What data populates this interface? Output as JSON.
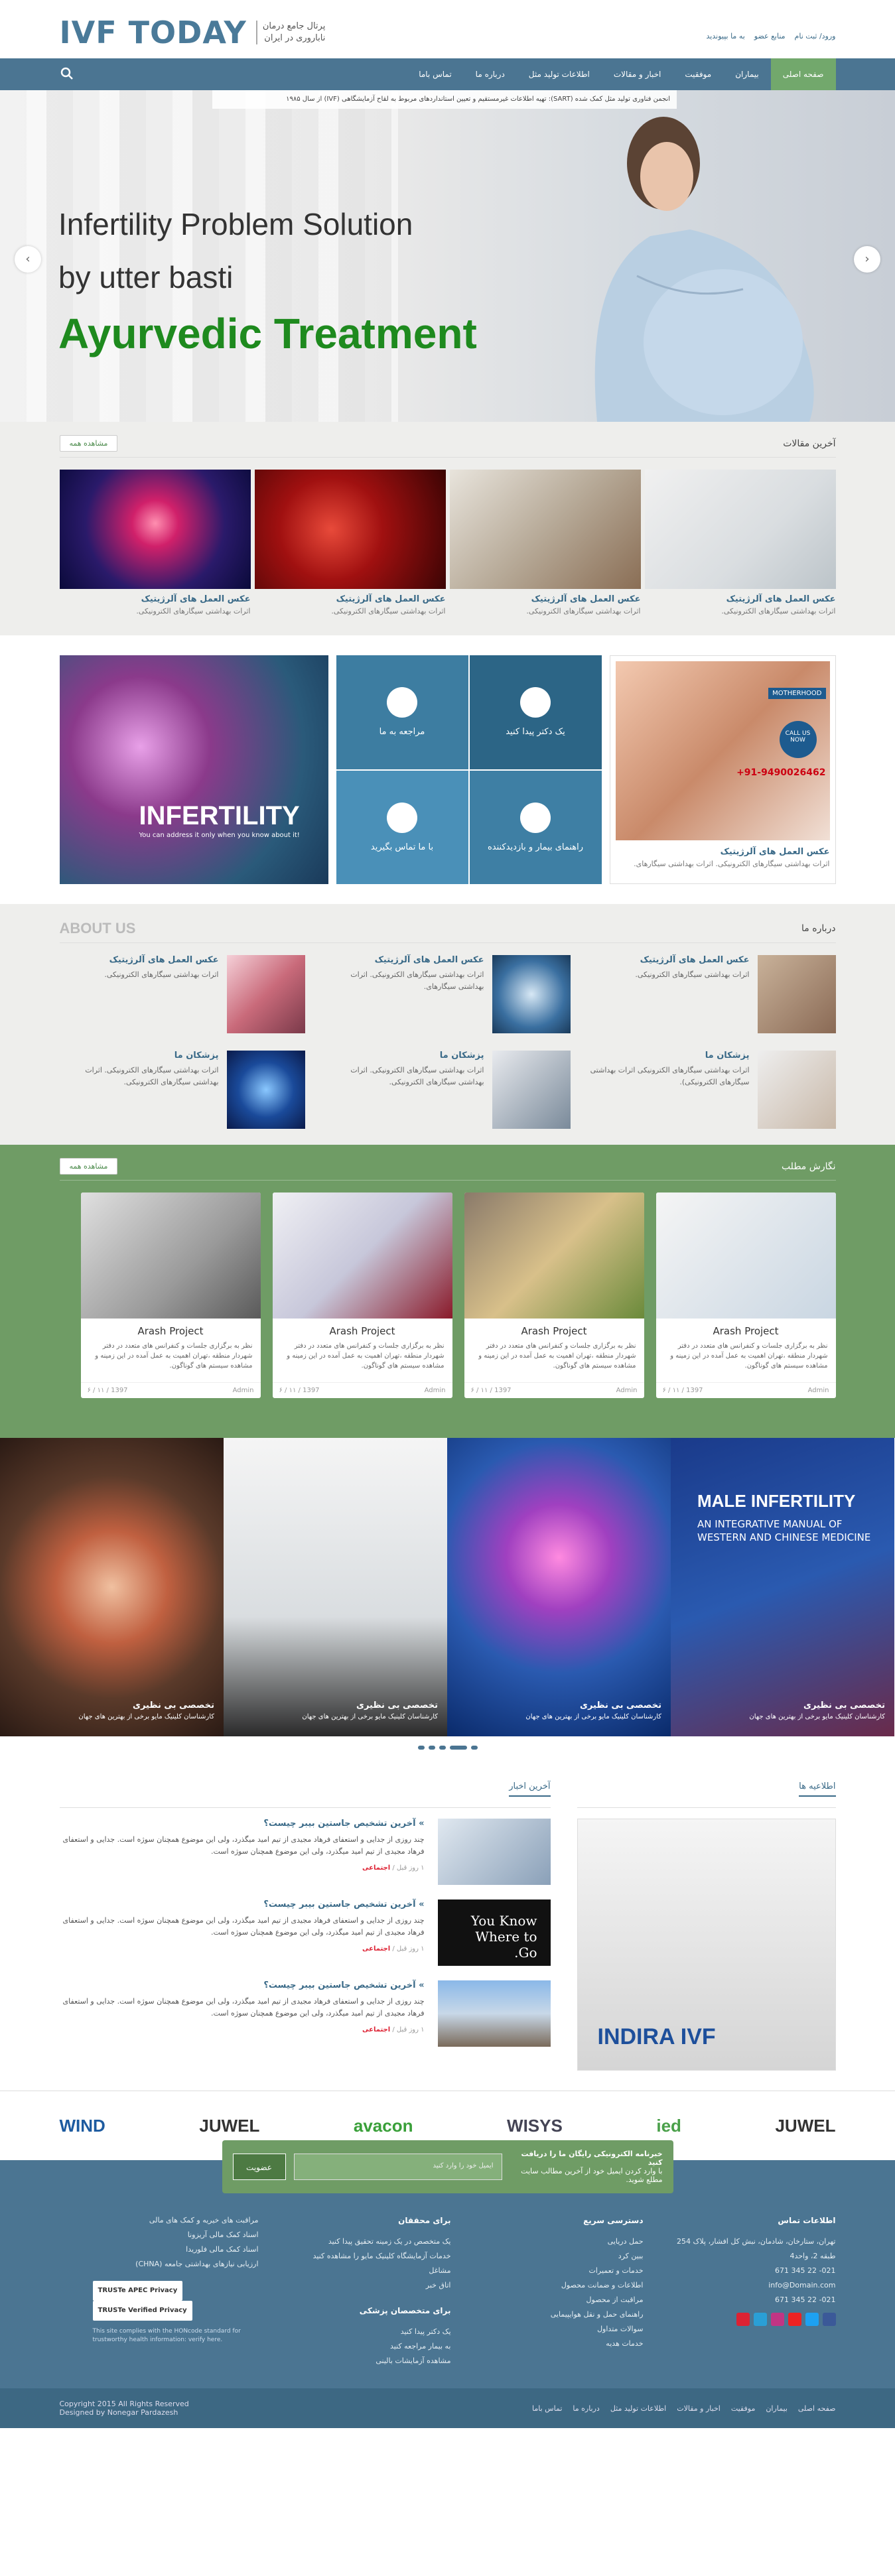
{
  "brand": {
    "logo_text": "IVF TODAY",
    "subtitle_1": "پرتال جامع درمان",
    "subtitle_2": "ناباروری در ایران"
  },
  "toplinks": [
    "ورود/ ثبت نام",
    "منابع عضو",
    "به ما بپیوندید"
  ],
  "nav": {
    "items": [
      "صفحه اصلی",
      "بیماران",
      "موفقیت",
      "اخبار و مقالات",
      "اطلاعات تولید مثل",
      "درباره ما",
      "تماس باما"
    ],
    "active": 0
  },
  "hero": {
    "ticker": "انجمن فناوری تولید مثل کمک شده (SART): تهیه اطلاعات غیرمستقیم و تعیین استانداردهای مربوط به لقاح آزمایشگاهی (IVF) از سال ۱۹۸۵",
    "line1": "Infertility Problem Solution",
    "line2": "by utter basti",
    "line3": "Ayurvedic Treatment",
    "prev": "‹",
    "next": "›"
  },
  "articles": {
    "title": "آخرین مقالات",
    "view_all": "مشاهده همه",
    "items": [
      {
        "title": "عکس العمل های آلرژیتیک",
        "desc": "اثرات بهداشتی سیگارهای الکترونیکی."
      },
      {
        "title": "عکس العمل های آلرژیتیک",
        "desc": "اثرات بهداشتی سیگارهای الکترونیکی."
      },
      {
        "title": "عکس العمل های آلرژیتیک",
        "desc": "اثرات بهداشتی سیگارهای الکترونیکی."
      },
      {
        "title": "عکس العمل های آلرژیتیک",
        "desc": "اثرات بهداشتی سیگارهای الکترونیکی."
      }
    ]
  },
  "services": {
    "banner_big": "INFERTILITY",
    "banner_small": "You can address it only when you know about it!",
    "tiles": [
      "یک دکتر پیدا کنید",
      "مراجعه به ما",
      "راهنمای بیمار و بازدیدکننده",
      "با ما تماس بگیرید"
    ],
    "feature": {
      "badge": "MOTHERHOOD",
      "call": "CALL US NOW",
      "phone": "+91-9490026462",
      "title": "عکس العمل های آلرژیتیک",
      "desc": "اثرات بهداشتی سیگارهای الکترونیکی. اثرات بهداشتی سیگارهای."
    }
  },
  "about": {
    "title_en": "ABOUT US",
    "title_fa": "درباره ما",
    "items": [
      {
        "title": "عکس العمل های آلرژیتیک",
        "desc": "اثرات بهداشتی سیگارهای الکترونیکی."
      },
      {
        "title": "عکس العمل های آلرژیتیک",
        "desc": "اثرات بهداشتی سیگارهای الکترونیکی. اثرات بهداشتی سیگارهای."
      },
      {
        "title": "عکس العمل های آلرژیتیک",
        "desc": "اثرات بهداشتی سیگارهای الکترونیکی."
      },
      {
        "title": "پزشکان ما",
        "desc": "اثرات بهداشتی سیگارهای الکترونیکی اثرات بهداشتی سیگارهای الکترونیکی)."
      },
      {
        "title": "پزشکان ما",
        "desc": "اثرات بهداشتی سیگارهای الکترونیکی. اثرات بهداشتی سیگارهای الکترونیکی."
      },
      {
        "title": "پزشکان ما",
        "desc": "اثرات بهداشتی سیگارهای الکترونیکی. اثرات بهداشتی سیگارهای الکترونیکی."
      }
    ]
  },
  "projects": {
    "title": "نگارش مطلب",
    "view_all": "مشاهده همه",
    "items": [
      {
        "title": "Arash Project",
        "desc": "نظر به برگزاری جلسات و کنفرانس های متعدد در دفتر شهردار منطقه ،تهران اهمیت به عمل آمده در این زمینه و مشاهده سیستم های گوناگون.",
        "date": "1397 / ۱۱ / ۶",
        "author": "Admin"
      },
      {
        "title": "Arash Project",
        "desc": "نظر به برگزاری جلسات و کنفرانس های متعدد در دفتر شهردار منطقه ،تهران اهمیت به عمل آمده در این زمینه و مشاهده سیستم های گوناگون.",
        "date": "1397 / ۱۱ / ۶",
        "author": "Admin"
      },
      {
        "title": "Arash Project",
        "desc": "نظر به برگزاری جلسات و کنفرانس های متعدد در دفتر شهردار منطقه ،تهران اهمیت به عمل آمده در این زمینه و مشاهده سیستم های گوناگون.",
        "date": "1397 / ۱۱ / ۶",
        "author": "Admin"
      },
      {
        "title": "Arash Project",
        "desc": "نظر به برگزاری جلسات و کنفرانس های متعدد در دفتر شهردار منطقه ،تهران اهمیت به عمل آمده در این زمینه و مشاهده سیستم های گوناگون.",
        "date": "1397 / ۱۱ / ۶",
        "author": "Admin"
      }
    ]
  },
  "banner": {
    "items": [
      {
        "a": "تخصصی بی نظیری",
        "b": "کارشناسان کلینیک مایو برخی از بهترین های جهان"
      },
      {
        "a": "تخصصی بی نظیری",
        "b": "کارشناسان کلینیک مایو برخی از بهترین های جهان"
      },
      {
        "a": "تخصصی بی نظیری",
        "b": "کارشناسان کلینیک مایو برخی از بهترین های جهان"
      },
      {
        "a": "تخصصی بی نظیری",
        "b": "کارشناسان کلینیک مایو برخی از بهترین های جهان"
      }
    ],
    "book_title": "MALE INFERTILITY",
    "book_sub": "AN INTEGRATIVE MANUAL OF WESTERN AND CHINESE MEDICINE"
  },
  "news": {
    "tab_news": "آخرین اخبار",
    "tab_ads": "اطلاعیه ها",
    "ad_brand": "INDIRA IVF",
    "img2_text": "You Know Where to Go.",
    "items": [
      {
        "title": "» آخرین تشخیص جاستین بیبر چیست؟",
        "desc": "چند روزی از جدایی و استعفای فرهاد مجیدی از تیم امید میگذرد، ولی این موضوع همچنان سوژه است. جدایی و استعفای فرهاد مجیدی از تیم امید میگذرد، ولی این موضوع همچنان سوژه است.",
        "meta": "۱ روز قبل /",
        "tag": "اجتماعی"
      },
      {
        "title": "» آخرین تشخیص جاستین بیبر چیست؟",
        "desc": "چند روزی از جدایی و استعفای فرهاد مجیدی از تیم امید میگذرد، ولی این موضوع همچنان سوژه است. جدایی و استعفای فرهاد مجیدی از تیم امید میگذرد، ولی این موضوع همچنان سوژه است.",
        "meta": "۱ روز قبل /",
        "tag": "اجتماعی"
      },
      {
        "title": "» آخرین تشخیص جاستین بیبر چیست؟",
        "desc": "چند روزی از جدایی و استعفای فرهاد مجیدی از تیم امید میگذرد، ولی این موضوع همچنان سوژه است. جدایی و استعفای فرهاد مجیدی از تیم امید میگذرد، ولی این موضوع همچنان سوژه است.",
        "meta": "۱ روز قبل /",
        "tag": "اجتماعی"
      }
    ]
  },
  "logos": [
    "WIND",
    "JUWEL",
    "avacon",
    "WISYS",
    "ied",
    "JUWEL"
  ],
  "newsletter": {
    "title": "خبرنامه الکترونیکی رایگان ما را دریافت کنید",
    "subtitle": "با وارد کردن ایمیل خود از آخرین مطالب سایت مطلع شوید.",
    "placeholder": "ایمیل خود را وارد کنید",
    "button": "عضویت"
  },
  "footer": {
    "contact": {
      "title": "اطلاعات تماس",
      "address": "تهران، ستارخان، شادمان، نبش کل افشار، پلاک 254 طبقه 2، واحد4",
      "phone1": "021- 22 345 671",
      "email": "info@Domain.com",
      "phone2": "021- 22 345 671"
    },
    "access": {
      "title": "دسترسی سریع",
      "items": [
        "حمل دریایی",
        "ببین کرد",
        "خدمات و تعمیرات",
        "اطلاعات و ضمانت محصول",
        "مراقبت از محصول",
        "راهنمای حمل و نقل هوایپیمایی",
        "سوالات متداول",
        "خدمات هدیه"
      ]
    },
    "researchers": {
      "title": "برای محققان",
      "items": [
        "یک متخصص در یک زمینه تحقیق پیدا کنید",
        "خدمات آزمایشگاه کلینیک مایو را مشاهده کنید",
        "مشاغل",
        "اتاق خبر"
      ]
    },
    "specialists": {
      "title": "برای متخصصان پزشکی",
      "items": [
        "یک دکتر پیدا کنید",
        "به بیمار مراجعه کنید",
        "مشاهده آزمایشات بالینی"
      ]
    },
    "extra": {
      "items": [
        "مراقبت های خیریه و کمک های مالی",
        "اسناد کمک مالی آریزونا",
        "اسناد کمک مالی فلوریدا",
        "ارزیابی نیازهای بهداشتی جامعه (CHNA)"
      ]
    },
    "badges": [
      "TRUSTe APEC Privacy",
      "TRUSTe Verified Privacy"
    ],
    "hon": "This site complies with the HONcode standard for trustworthy health information: verify here.",
    "copyright": "Copyright 2015 All Rights Reserved",
    "designed": "Designed by Nonegar Pardazesh",
    "bottom_links": [
      "صفحه اصلی",
      "بیماران",
      "موفقیت",
      "اخبار و مقالات",
      "اطلاعات تولید مثل",
      "درباره ما",
      "تماس باما"
    ]
  }
}
